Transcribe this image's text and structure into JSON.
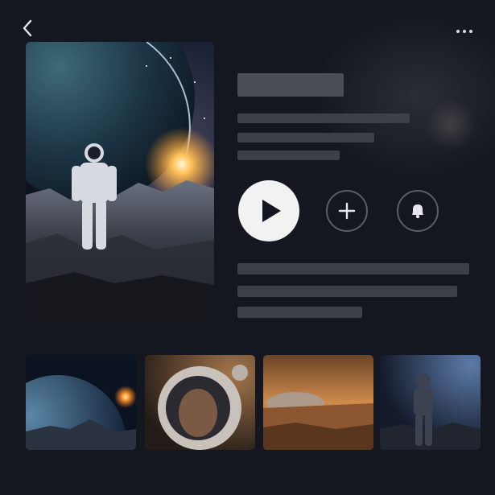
{
  "header": {
    "back_icon": "chevron-left-icon",
    "more_icon": "more-horizontal-icon"
  },
  "hero": {
    "poster_subject": "astronaut-on-planet"
  },
  "actions": {
    "play_icon": "play-icon",
    "add_icon": "plus-icon",
    "notify_icon": "bell-icon"
  },
  "thumbnails": [
    {
      "subject": "planet-horizon"
    },
    {
      "subject": "astronaut-helmet-portrait"
    },
    {
      "subject": "desert-planet-landscape"
    },
    {
      "subject": "astronaut-standing"
    }
  ],
  "colors": {
    "background": "#14171f",
    "skeleton": "#3d4049",
    "play_button": "#f2f2f2",
    "icon_stroke": "#e6e7ea"
  }
}
